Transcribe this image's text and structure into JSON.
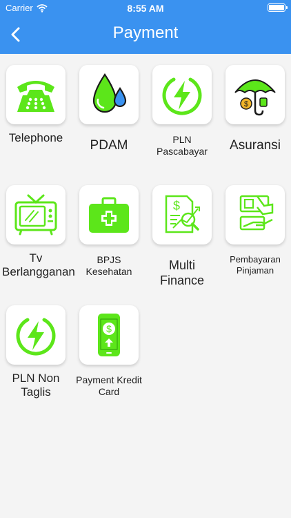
{
  "status": {
    "carrier": "Carrier",
    "time": "8:55 AM"
  },
  "header": {
    "title": "Payment"
  },
  "colors": {
    "accent": "#3a92f0",
    "icon_green": "#5ce61a"
  },
  "items": [
    {
      "label": "Telephone",
      "icon": "telephone-icon"
    },
    {
      "label": "PDAM",
      "icon": "water-drop-icon"
    },
    {
      "label": "PLN Pascabayar",
      "icon": "lightning-icon"
    },
    {
      "label": "Asuransi",
      "icon": "umbrella-icon"
    },
    {
      "label": "Tv Berlangganan",
      "icon": "tv-icon"
    },
    {
      "label": "BPJS Kesehatan",
      "icon": "medical-kit-icon"
    },
    {
      "label": "Multi Finance",
      "icon": "finance-chart-icon"
    },
    {
      "label": "Pembayaran Pinjaman",
      "icon": "loan-hand-icon"
    },
    {
      "label": "PLN Non Taglis",
      "icon": "lightning-icon"
    },
    {
      "label": "Payment Kredit Card",
      "icon": "phone-payment-icon"
    }
  ]
}
